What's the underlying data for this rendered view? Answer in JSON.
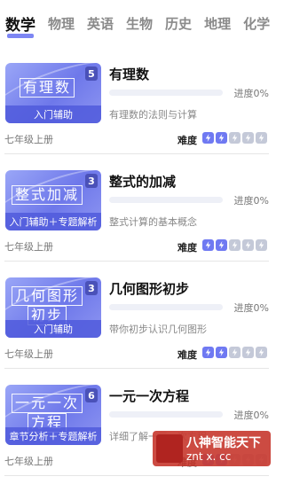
{
  "tabs": [
    {
      "label": "数学",
      "active": true
    },
    {
      "label": "物理",
      "active": false
    },
    {
      "label": "英语",
      "active": false
    },
    {
      "label": "生物",
      "active": false
    },
    {
      "label": "历史",
      "active": false
    },
    {
      "label": "地理",
      "active": false
    },
    {
      "label": "化学",
      "active": false
    }
  ],
  "difficulty_label": "难度",
  "courses": [
    {
      "thumb_lines": [
        "有理数"
      ],
      "thumb_count": "5",
      "thumb_tag": "入门辅助",
      "title": "有理数",
      "progress_text": "进度0%",
      "progress_fraction": 0,
      "description": "有理数的法则与计算",
      "grade": "七年级上册",
      "difficulty_level": 2,
      "difficulty_max": 5
    },
    {
      "thumb_lines": [
        "整式加减"
      ],
      "thumb_count": "3",
      "thumb_tag": "入门辅助＋专题解析",
      "title": "整式的加减",
      "progress_text": "进度0%",
      "progress_fraction": 0,
      "description": "整式计算的基本概念",
      "grade": "七年级上册",
      "difficulty_level": 2,
      "difficulty_max": 5
    },
    {
      "thumb_lines": [
        "几何图形",
        "初步"
      ],
      "thumb_count": "3",
      "thumb_tag": "入门辅助",
      "title": "几何图形初步",
      "progress_text": "进度0%",
      "progress_fraction": 0,
      "description": "带你初步认识几何图形",
      "grade": "七年级上册",
      "difficulty_level": 2,
      "difficulty_max": 5
    },
    {
      "thumb_lines": [
        "一元一次",
        "方程"
      ],
      "thumb_count": "6",
      "thumb_tag": "章节分析＋专题解析",
      "title": "一元一次方程",
      "progress_text": "进度0%",
      "progress_fraction": 0,
      "description": "详细了解一元一次方程",
      "grade": "七年级上册",
      "difficulty_level": 2,
      "difficulty_max": 5
    }
  ],
  "watermark": {
    "line1": "八神智能天下",
    "line2": "znt x. cc"
  },
  "colors": {
    "accent": "#6f79f2",
    "inactive_bolt": "#c4c9d8",
    "watermark": "#c83c32"
  }
}
